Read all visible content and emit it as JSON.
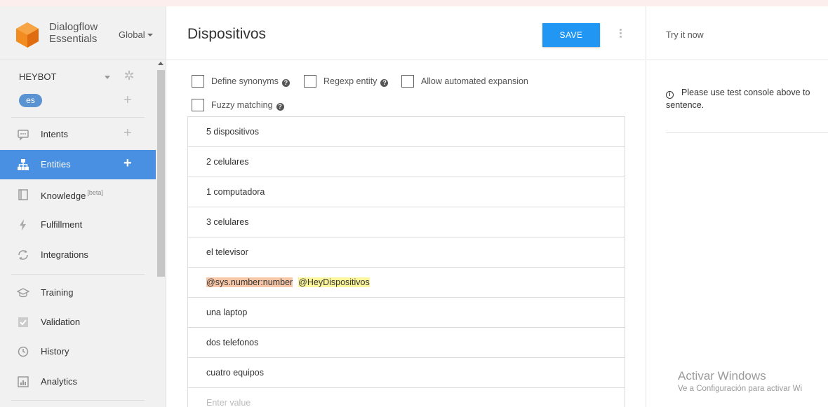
{
  "brand": {
    "line1": "Dialogflow",
    "line2": "Essentials",
    "region": "Global"
  },
  "agent": {
    "name": "HEYBOT",
    "language": "es"
  },
  "nav": [
    {
      "id": "intents",
      "icon": "chat-icon",
      "label": "Intents",
      "plus": true,
      "active": false
    },
    {
      "id": "entities",
      "icon": "sitemap-icon",
      "label": "Entities",
      "plus": true,
      "active": true
    },
    {
      "id": "knowledge",
      "icon": "book-icon",
      "label": "Knowledge",
      "badge": "[beta]",
      "plus": false,
      "active": false
    },
    {
      "id": "fulfillment",
      "icon": "bolt-icon",
      "label": "Fulfillment",
      "plus": false,
      "active": false
    },
    {
      "id": "integrations",
      "icon": "sync-icon",
      "label": "Integrations",
      "plus": false,
      "active": false
    },
    {
      "id": "training",
      "icon": "graduation-cap-icon",
      "label": "Training",
      "plus": false,
      "active": false
    },
    {
      "id": "validation",
      "icon": "check-box-icon",
      "label": "Validation",
      "plus": false,
      "active": false
    },
    {
      "id": "history",
      "icon": "clock-icon",
      "label": "History",
      "plus": false,
      "active": false
    },
    {
      "id": "analytics",
      "icon": "bar-chart-icon",
      "label": "Analytics",
      "plus": false,
      "active": false
    }
  ],
  "main": {
    "title": "Dispositivos",
    "save_label": "SAVE",
    "options": [
      {
        "label": "Define synonyms",
        "help": true,
        "checked": false
      },
      {
        "label": "Regexp entity",
        "help": true,
        "checked": false
      },
      {
        "label": "Allow automated expansion",
        "help": false,
        "checked": false
      },
      {
        "label": "Fuzzy matching",
        "help": true,
        "checked": false
      }
    ],
    "entries": [
      "5 dispositivos",
      "2 celulares",
      "1 computadora",
      "3 celulares",
      "el televisor",
      "@sys.number:number @HeyDispositivos",
      "una laptop",
      "dos telefonos",
      "cuatro equipos"
    ],
    "entry_tokens": {
      "token1": "@sys.number:number",
      "token2": "@HeyDispositivos"
    },
    "entry_placeholder": "Enter value"
  },
  "right": {
    "try_label": "Try it now",
    "notice_line1": "Please use test console above to",
    "notice_line2": "sentence."
  },
  "watermark": {
    "title": "Activar Windows",
    "subtitle": "Ve a Configuración para activar Wi"
  },
  "colors": {
    "accent": "#2196f3",
    "nav_active": "#4a90e2",
    "lang_badge": "#5a93d1",
    "token1": "#f8c7a7",
    "token2": "#fbf59c"
  }
}
